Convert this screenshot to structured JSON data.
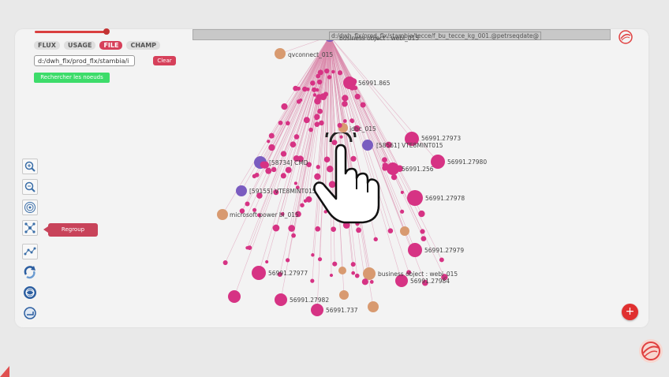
{
  "tabs": [
    {
      "label": "FLUX",
      "active": false
    },
    {
      "label": "USAGE",
      "active": false
    },
    {
      "label": "FILE",
      "active": true
    },
    {
      "label": "CHAMP",
      "active": false
    }
  ],
  "path_input": {
    "value": "d:/dwh_flx/prod_flx/stambia/i"
  },
  "clear_label": "Clear",
  "search_label": "Rechercher les noeuds",
  "path_bar": {
    "text": "d:/dwh_flx/prod_flx/stambia/tecce/f_bu_tecce_kg_001.@petrseqdate@"
  },
  "regroup_label": "Regroup",
  "fab_label": "+",
  "toolbar_icons": [
    "zoom-in-icon",
    "zoom-out-icon",
    "target-icon",
    "network-icon",
    "graph-layout-icon",
    "refresh-icon",
    "globe-icon",
    "export-icon"
  ],
  "colors": {
    "accent": "#d6405a",
    "node_pink": "#d63384",
    "node_purple": "#7a5cc0",
    "node_orange": "#d89a70",
    "green": "#3ddc6a"
  },
  "graph": {
    "labels": [
      {
        "id": "top",
        "text": "business object : webi_015"
      },
      {
        "id": "qv",
        "text": "qvconnect_015"
      },
      {
        "id": "n865",
        "text": "56991.865"
      },
      {
        "id": "jdbc",
        "text": "jdbc_015"
      },
      {
        "id": "n973",
        "text": "56991.27973"
      },
      {
        "id": "vte1",
        "text": "[58561] VTE8MINT015"
      },
      {
        "id": "n980",
        "text": "56991.27980"
      },
      {
        "id": "n256",
        "text": "56991.256"
      },
      {
        "id": "cmd",
        "text": "[58734] CMD"
      },
      {
        "id": "vte2",
        "text": "[59155] VTE8MINT015"
      },
      {
        "id": "n978",
        "text": "56991.27978"
      },
      {
        "id": "ms",
        "text": "microsoft power bi_015"
      },
      {
        "id": "n979",
        "text": "56991.27979"
      },
      {
        "id": "n977",
        "text": "56991.27977"
      },
      {
        "id": "bo",
        "text": "business object : webi_015"
      },
      {
        "id": "n984",
        "text": "56991.27984"
      },
      {
        "id": "n982",
        "text": "56991.27982"
      },
      {
        "id": "n737",
        "text": "56991.737"
      }
    ]
  }
}
